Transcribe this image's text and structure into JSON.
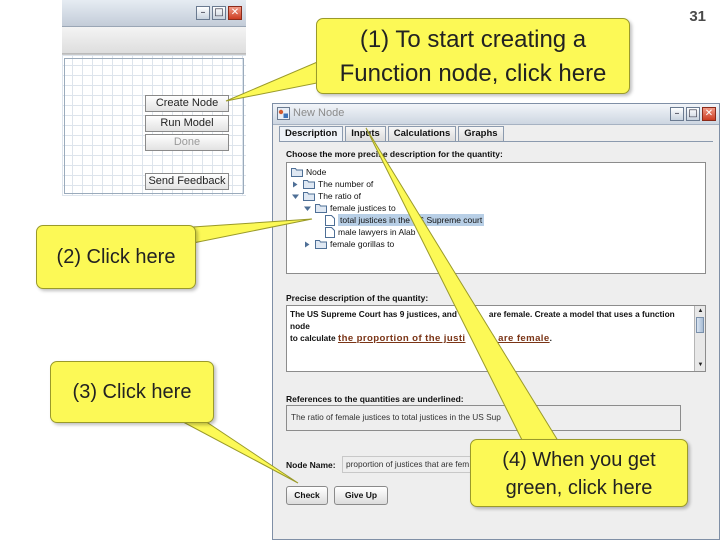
{
  "slide_number": "31",
  "left_window": {
    "buttons": {
      "create_node": "Create Node",
      "run_model": "Run Model",
      "done": "Done",
      "send_feedback": "Send Feedback"
    }
  },
  "dialog": {
    "title": "New Node",
    "tabs": [
      "Description",
      "Inputs",
      "Calculations",
      "Graphs"
    ],
    "active_tab": "Description",
    "tree_heading": "Choose the more precise description for the quantity:",
    "tree": {
      "root": "Node",
      "number_of": "The number of",
      "ratio_of": "The ratio of",
      "female_justices_to": "female justices to",
      "total_justices": "total justices in the US Supreme court",
      "male_lawyers": "male lawyers in Alab",
      "female_gorillas": "female gorillas to"
    },
    "precise_heading": "Precise description of the quantity:",
    "precise_text_line1": "The US Supreme Court has 9 justices, and",
    "precise_text_line1b": "are female. Create a model that uses a function node",
    "precise_text_line2": "to calculate",
    "precise_link": "the proportion of the justi",
    "precise_link_end": "t are female",
    "precise_text_end": ".",
    "references_heading": "References to the quantities are underlined:",
    "references_text": "The ratio of female justices to total justices in the US Sup",
    "node_name_label": "Node Name:",
    "node_name_value": "proportion of justices that are fem",
    "check_button": "Check",
    "give_up_button": "Give Up"
  },
  "callouts": {
    "c1": "(1) To start creating a Function node, click here",
    "c2": "(2) Click here",
    "c3": "(3) Click here",
    "c4": "(4) When you get green, click here"
  },
  "colors": {
    "callout_fill": "#fcf956",
    "link_color": "#7a3416",
    "selection": "#b8cfe6"
  }
}
